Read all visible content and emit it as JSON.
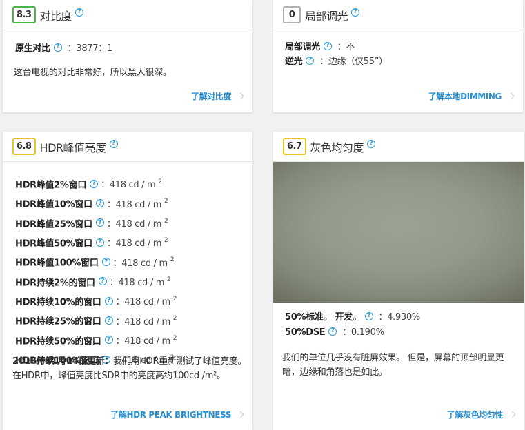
{
  "contrast": {
    "score": "8.3",
    "title": "对比度",
    "rows": [
      {
        "label": "原生对比",
        "value": "：3877：1"
      }
    ],
    "description": "这台电视的对比非常好，所以黑人很深。",
    "learn_more": "了解对比度"
  },
  "local_dimming": {
    "score": "0",
    "title": "局部调光",
    "rows": [
      {
        "label": "局部调光",
        "value": "：不"
      },
      {
        "label": "逆光",
        "value": "：边缘（仅55”）"
      }
    ],
    "learn_more": "了解本地DIMMING"
  },
  "hdr_peak": {
    "score": "6.8",
    "title": "HDR峰值亮度",
    "unit": "418 cd / m",
    "unit_sup": "2",
    "rows": [
      {
        "label": "HDR峰值2%窗口"
      },
      {
        "label": "HDR峰值10%窗口"
      },
      {
        "label": "HDR峰值25%窗口"
      },
      {
        "label": "HDR峰值50%窗口"
      },
      {
        "label": "HDR峰值100%窗口"
      },
      {
        "label": "HDR持续2%的窗口"
      },
      {
        "label": "HDR持续10%的窗口"
      },
      {
        "label": "HDR持续25%的窗口"
      },
      {
        "label": "HDR持续50%的窗口"
      },
      {
        "label": "HDR持续100%窗口"
      }
    ],
    "update_bold": "2016年11月14日更新：",
    "update_text": "我们用HDR重新测试了峰值亮度。 在HDR中，峰值亮度比SDR中的亮度高约100cd /m²。",
    "learn_more": "了解HDR PEAK BRIGHTNESS"
  },
  "gray_uniformity": {
    "score": "6.7",
    "title": "灰色均匀度",
    "rows": [
      {
        "label": "50%标准。 开发。",
        "value": "：4.930%"
      },
      {
        "label": "50%DSE",
        "value": "：0.190%"
      }
    ],
    "description": "我们的单位几乎没有脏屏效果。 但是，屏幕的顶部明显更暗，边缘和角落也是如此。",
    "learn_more": "了解灰色均匀性"
  },
  "help_glyph": "?",
  "colors": {
    "score_green": "#4bb54b",
    "score_gray": "#b0b0b0",
    "score_yellow": "#e6c629",
    "link_blue": "#2a8fd0"
  }
}
